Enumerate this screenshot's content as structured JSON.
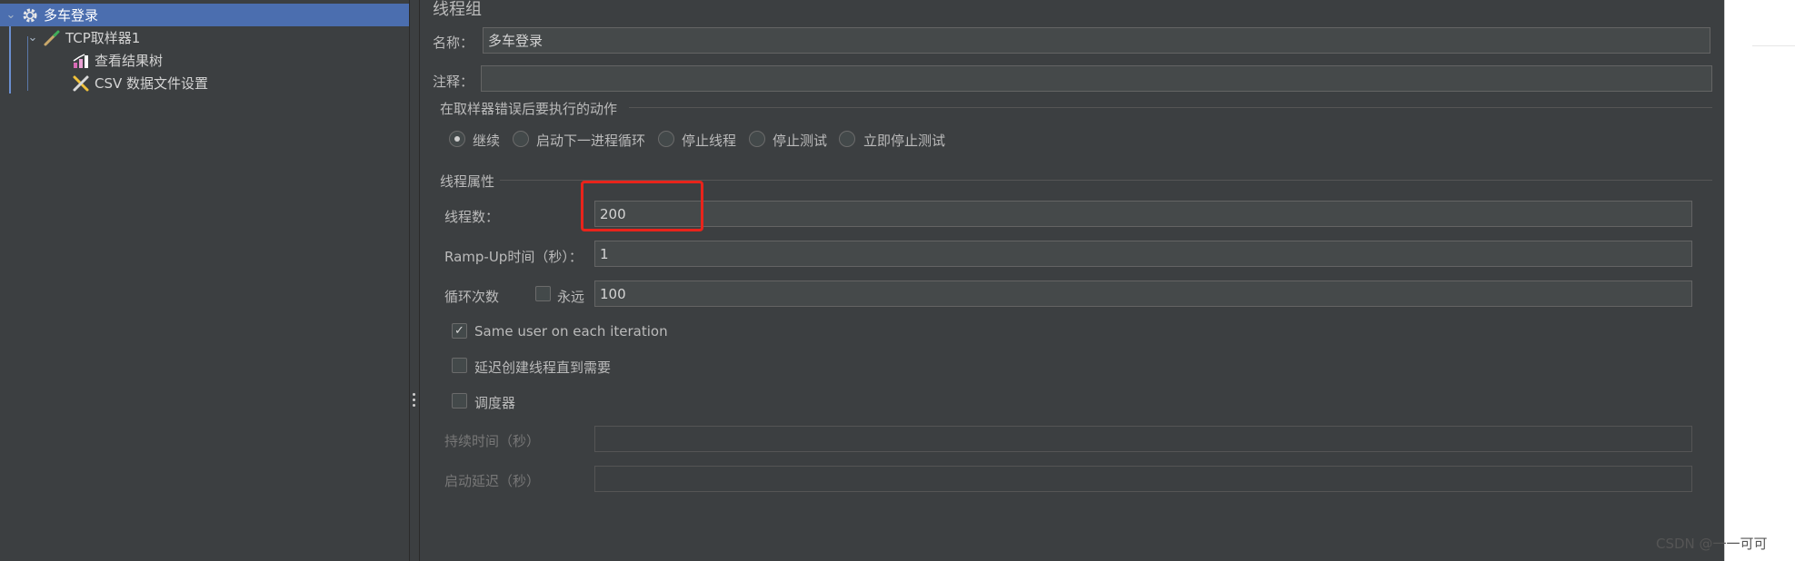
{
  "tree": {
    "items": [
      {
        "label": "多车登录",
        "icon": "gear-icon",
        "expanded": true,
        "selected": true
      },
      {
        "label": "TCP取样器1",
        "icon": "pipette-icon",
        "expanded": true
      },
      {
        "label": "查看结果树",
        "icon": "chart-icon"
      },
      {
        "label": "CSV 数据文件设置",
        "icon": "wrench-screwdriver-icon"
      }
    ]
  },
  "panel": {
    "title": "线程组",
    "name_label": "名称：",
    "name_value": "多车登录",
    "comment_label": "注释：",
    "comment_value": "",
    "error_action": {
      "group_label": "在取样器错误后要执行的动作",
      "options": [
        "继续",
        "启动下一进程循环",
        "停止线程",
        "停止测试",
        "立即停止测试"
      ],
      "selected": "继续"
    },
    "thread_props": {
      "group_label": "线程属性",
      "threads_label": "线程数：",
      "threads_value": "200",
      "rampup_label": "Ramp-Up时间（秒）：",
      "rampup_value": "1",
      "loop_label": "循环次数",
      "forever_label": "永远",
      "forever_checked": false,
      "loop_value": "100",
      "same_user_label": "Same user on each iteration",
      "same_user_checked": true,
      "delay_label": "延迟创建线程直到需要",
      "delay_checked": false,
      "scheduler_label": "调度器",
      "scheduler_checked": false,
      "duration_label": "持续时间（秒）",
      "duration_value": "",
      "startup_delay_label": "启动延迟（秒）",
      "startup_delay_value": ""
    }
  },
  "watermark": "CSDN @一一可可",
  "colors": {
    "highlight": "#e8241b",
    "selection": "#4b6eaf",
    "background": "#3c3f41"
  }
}
